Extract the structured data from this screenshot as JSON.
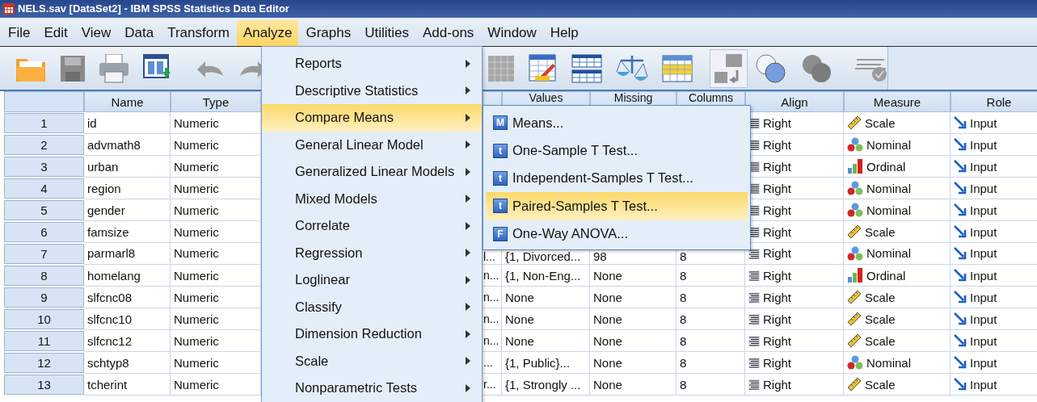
{
  "window": {
    "title": "NELS.sav [DataSet2] - IBM SPSS Statistics Data Editor"
  },
  "menu_bar": [
    {
      "label": "File",
      "selected": false
    },
    {
      "label": "Edit",
      "selected": false
    },
    {
      "label": "View",
      "selected": false
    },
    {
      "label": "Data",
      "selected": false
    },
    {
      "label": "Transform",
      "selected": false
    },
    {
      "label": "Analyze",
      "selected": true
    },
    {
      "label": "Graphs",
      "selected": false
    },
    {
      "label": "Utilities",
      "selected": false
    },
    {
      "label": "Add-ons",
      "selected": false
    },
    {
      "label": "Window",
      "selected": false
    },
    {
      "label": "Help",
      "selected": false
    }
  ],
  "table": {
    "columns": [
      "Name",
      "Type",
      "Values",
      "Missing",
      "Columns",
      "Align",
      "Measure",
      "Role"
    ],
    "rows": [
      {
        "number": "1",
        "name": "id",
        "type": "Numeric",
        "align": "Right",
        "measure": {
          "kind": "scale",
          "label": "Scale"
        },
        "role": "Input"
      },
      {
        "number": "2",
        "name": "advmath8",
        "type": "Numeric",
        "align": "Right",
        "measure": {
          "kind": "nominal",
          "label": "Nominal"
        },
        "role": "Input"
      },
      {
        "number": "3",
        "name": "urban",
        "type": "Numeric",
        "align": "Right",
        "measure": {
          "kind": "ordinal",
          "label": "Ordinal"
        },
        "role": "Input"
      },
      {
        "number": "4",
        "name": "region",
        "type": "Numeric",
        "align": "Right",
        "measure": {
          "kind": "nominal",
          "label": "Nominal"
        },
        "role": "Input"
      },
      {
        "number": "5",
        "name": "gender",
        "type": "Numeric",
        "align": "Right",
        "measure": {
          "kind": "nominal",
          "label": "Nominal"
        },
        "role": "Input"
      },
      {
        "number": "6",
        "name": "famsize",
        "type": "Numeric",
        "align": "Right",
        "measure": {
          "kind": "scale",
          "label": "Scale"
        },
        "role": "Input"
      },
      {
        "number": "7",
        "name": "parmarl8",
        "type": "Numeric",
        "label": "l...",
        "values": "{1, Divorced...",
        "missing": "98",
        "columns": "8",
        "align": "Right",
        "measure": {
          "kind": "nominal",
          "label": "Nominal"
        },
        "role": "Input"
      },
      {
        "number": "8",
        "name": "homelang",
        "type": "Numeric",
        "label": "n...",
        "values": "{1, Non-Eng...",
        "missing": "None",
        "columns": "8",
        "align": "Right",
        "measure": {
          "kind": "ordinal",
          "label": "Ordinal"
        },
        "role": "Input"
      },
      {
        "number": "9",
        "name": "slfcnc08",
        "type": "Numeric",
        "label": "n...",
        "values": "None",
        "missing": "None",
        "columns": "8",
        "align": "Right",
        "measure": {
          "kind": "scale",
          "label": "Scale"
        },
        "role": "Input"
      },
      {
        "number": "10",
        "name": "slfcnc10",
        "type": "Numeric",
        "label": "n...",
        "values": "None",
        "missing": "None",
        "columns": "8",
        "align": "Right",
        "measure": {
          "kind": "scale",
          "label": "Scale"
        },
        "role": "Input"
      },
      {
        "number": "11",
        "name": "slfcnc12",
        "type": "Numeric",
        "label": "n...",
        "values": "None",
        "missing": "None",
        "columns": "8",
        "align": "Right",
        "measure": {
          "kind": "scale",
          "label": "Scale"
        },
        "role": "Input"
      },
      {
        "number": "12",
        "name": "schtyp8",
        "type": "Numeric",
        "label": "...",
        "values": "{1, Public}...",
        "missing": "None",
        "columns": "8",
        "align": "Right",
        "measure": {
          "kind": "nominal",
          "label": "Nominal"
        },
        "role": "Input"
      },
      {
        "number": "13",
        "name": "tcherint",
        "type": "Numeric",
        "label": "r...",
        "values": "{1, Strongly ...",
        "missing": "None",
        "columns": "8",
        "align": "Right",
        "measure": {
          "kind": "scale",
          "label": "Scale"
        },
        "role": "Input"
      }
    ]
  },
  "analyze_menu": {
    "items": [
      {
        "label": "Reports",
        "selected": false
      },
      {
        "label": "Descriptive Statistics",
        "selected": false
      },
      {
        "label": "Compare Means",
        "selected": true
      },
      {
        "label": "General Linear Model",
        "selected": false
      },
      {
        "label": "Generalized Linear Models",
        "selected": false
      },
      {
        "label": "Mixed Models",
        "selected": false
      },
      {
        "label": "Correlate",
        "selected": false
      },
      {
        "label": "Regression",
        "selected": false
      },
      {
        "label": "Loglinear",
        "selected": false
      },
      {
        "label": "Classify",
        "selected": false
      },
      {
        "label": "Dimension Reduction",
        "selected": false
      },
      {
        "label": "Scale",
        "selected": false
      },
      {
        "label": "Nonparametric Tests",
        "selected": false
      }
    ]
  },
  "compare_means_menu": {
    "items": [
      {
        "label": "Means...",
        "icon_letter": "M",
        "selected": false
      },
      {
        "label": "One-Sample T Test...",
        "icon_letter": "t",
        "selected": false
      },
      {
        "label": "Independent-Samples T Test...",
        "icon_letter": "t",
        "selected": false
      },
      {
        "label": "Paired-Samples T Test...",
        "icon_letter": "t",
        "selected": true
      },
      {
        "label": "One-Way ANOVA...",
        "icon_letter": "F",
        "selected": false
      }
    ]
  }
}
